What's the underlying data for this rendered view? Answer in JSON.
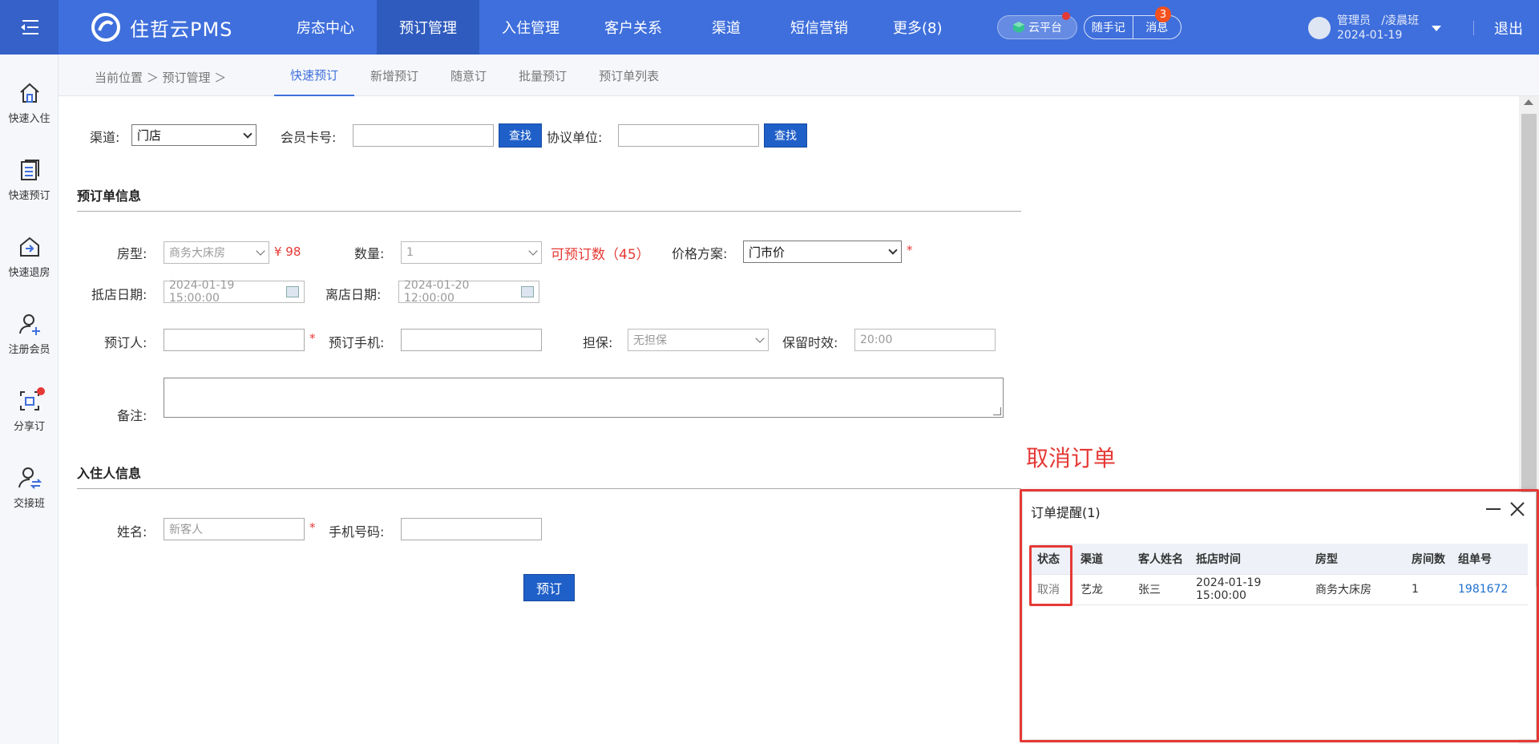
{
  "header": {
    "logo_text": "住哲云PMS",
    "nav": [
      "房态中心",
      "预订管理",
      "入住管理",
      "客户关系",
      "渠道",
      "短信营销",
      "更多(8)"
    ],
    "active_nav": 1,
    "cloud_label": "云平台",
    "notes_label": "随手记",
    "messages_label": "消息",
    "messages_badge": "3",
    "user_role": "管理员",
    "user_shift": "/凌晨班",
    "user_date": "2024-01-19",
    "logout": "退出"
  },
  "sidebar": {
    "items": [
      {
        "label": "快速入住",
        "icon": "home-icon"
      },
      {
        "label": "快速预订",
        "icon": "list-icon"
      },
      {
        "label": "快速退房",
        "icon": "checkout-icon"
      },
      {
        "label": "注册会员",
        "icon": "user-add-icon"
      },
      {
        "label": "分享订",
        "icon": "share-icon"
      },
      {
        "label": "交接班",
        "icon": "handover-icon"
      }
    ]
  },
  "subnav": {
    "breadcrumb": "当前位置 ＞ 预订管理 ＞",
    "tabs": [
      "快速预订",
      "新增预订",
      "随意订",
      "批量预订",
      "预订单列表"
    ],
    "active_tab": 0
  },
  "form": {
    "channel_label": "渠道:",
    "channel_value": "门店",
    "member_card_label": "会员卡号:",
    "member_card_value": "",
    "find_label": "查找",
    "agreement_label": "协议单位:",
    "agreement_value": "",
    "order_section": "预订单信息",
    "room_type_label": "房型:",
    "room_type_value": "商务大床房",
    "price": "¥ 98",
    "quantity_label": "数量:",
    "quantity_value": "1",
    "available": "可预订数（45）",
    "price_plan_label": "价格方案:",
    "price_plan_value": "门市价",
    "required_mark": "*",
    "arrive_label": "抵店日期:",
    "arrive_value": "2024-01-19 15:00:00",
    "leave_label": "离店日期:",
    "leave_value": "2024-01-20 12:00:00",
    "booker_label": "预订人:",
    "booker_value": "",
    "booker_phone_label": "预订手机:",
    "booker_phone_value": "",
    "guarantee_label": "担保:",
    "guarantee_value": "无担保",
    "hold_label": "保留时效:",
    "hold_value": "20:00",
    "remark_label": "备注:",
    "guest_section": "入住人信息",
    "name_label": "姓名:",
    "name_value": "新客人",
    "mobile_label": "手机号码:",
    "mobile_value": "",
    "submit_label": "预订"
  },
  "annotation": "取消订单",
  "popup": {
    "title": "订单提醒(1)",
    "columns": [
      "状态",
      "渠道",
      "客人姓名",
      "抵店时间",
      "房型",
      "房间数",
      "组单号"
    ],
    "rows": [
      [
        "取消",
        "艺龙",
        "张三",
        "2024-01-19 15:00:00",
        "商务大床房",
        "1",
        "1981672"
      ]
    ]
  },
  "colors": {
    "header": "#3f6fdc",
    "accent": "#1f5fc8",
    "alert": "#e53935"
  }
}
